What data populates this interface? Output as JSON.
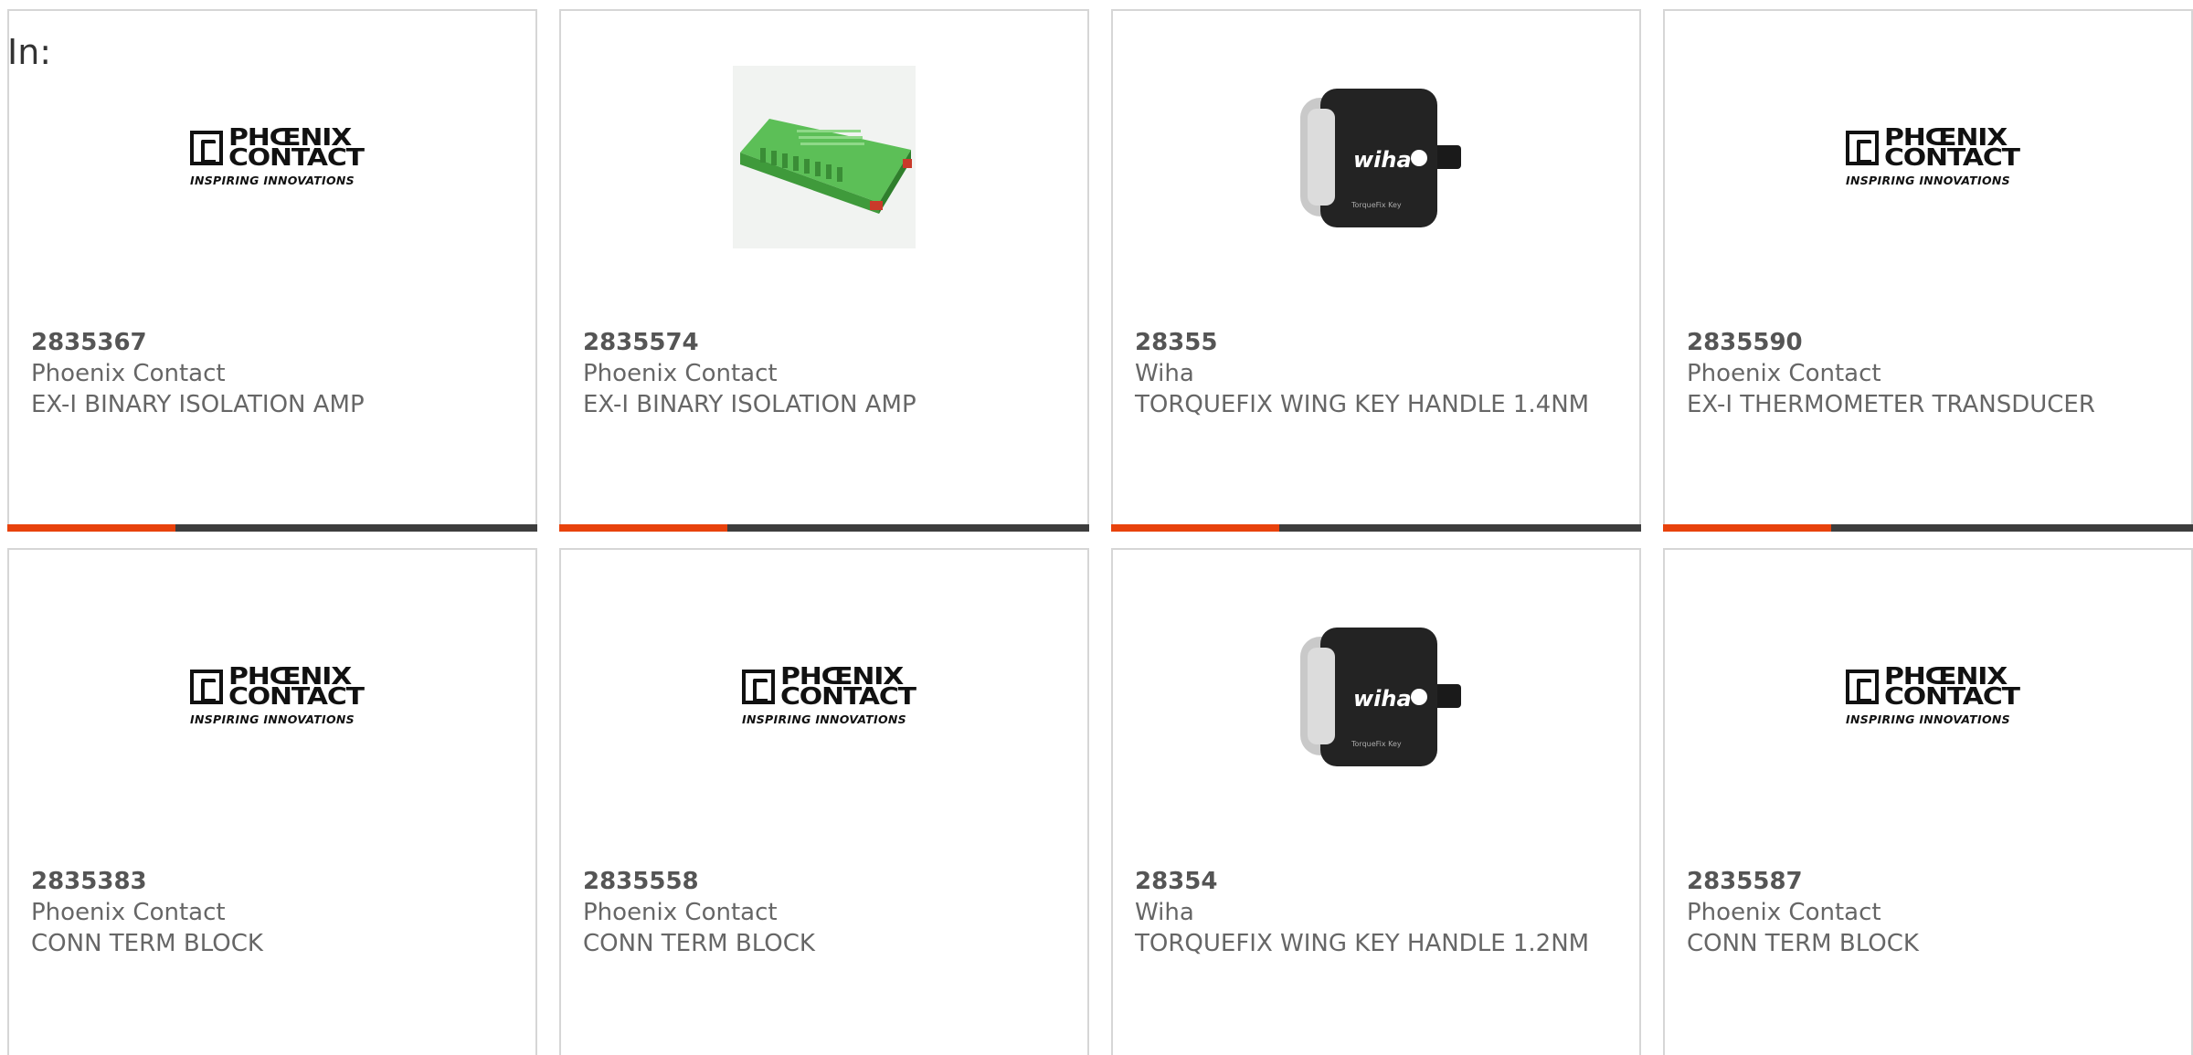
{
  "filter": {
    "label": "In:"
  },
  "colors": {
    "accent": "#e8420c",
    "bar": "#3d3d3d",
    "border": "#d6d6d6",
    "text": "#666666"
  },
  "logo": {
    "line1": "PHŒNIX",
    "line2": "CONTACT",
    "tagline": "INSPIRING INNOVATIONS"
  },
  "wiha": {
    "brand": "wiha",
    "product": "TorqueFix Key"
  },
  "products": [
    {
      "part_number": "2835367",
      "manufacturer": "Phoenix Contact",
      "description": "EX-I BINARY ISOLATION AMP",
      "image": "phoenix-contact-logo"
    },
    {
      "part_number": "2835574",
      "manufacturer": "Phoenix Contact",
      "description": "EX-I BINARY ISOLATION AMP",
      "image": "green-module-photo"
    },
    {
      "part_number": "28355",
      "manufacturer": "Wiha",
      "description": "TORQUEFIX WING KEY HANDLE 1.4NM",
      "image": "wiha-handle-photo"
    },
    {
      "part_number": "2835590",
      "manufacturer": "Phoenix Contact",
      "description": "EX-I THERMOMETER TRANSDUCER",
      "image": "phoenix-contact-logo"
    },
    {
      "part_number": "2835383",
      "manufacturer": "Phoenix Contact",
      "description": "CONN TERM BLOCK",
      "image": "phoenix-contact-logo"
    },
    {
      "part_number": "2835558",
      "manufacturer": "Phoenix Contact",
      "description": "CONN TERM BLOCK",
      "image": "phoenix-contact-logo"
    },
    {
      "part_number": "28354",
      "manufacturer": "Wiha",
      "description": "TORQUEFIX WING KEY HANDLE 1.2NM",
      "image": "wiha-handle-photo"
    },
    {
      "part_number": "2835587",
      "manufacturer": "Phoenix Contact",
      "description": "CONN TERM BLOCK",
      "image": "phoenix-contact-logo"
    }
  ]
}
